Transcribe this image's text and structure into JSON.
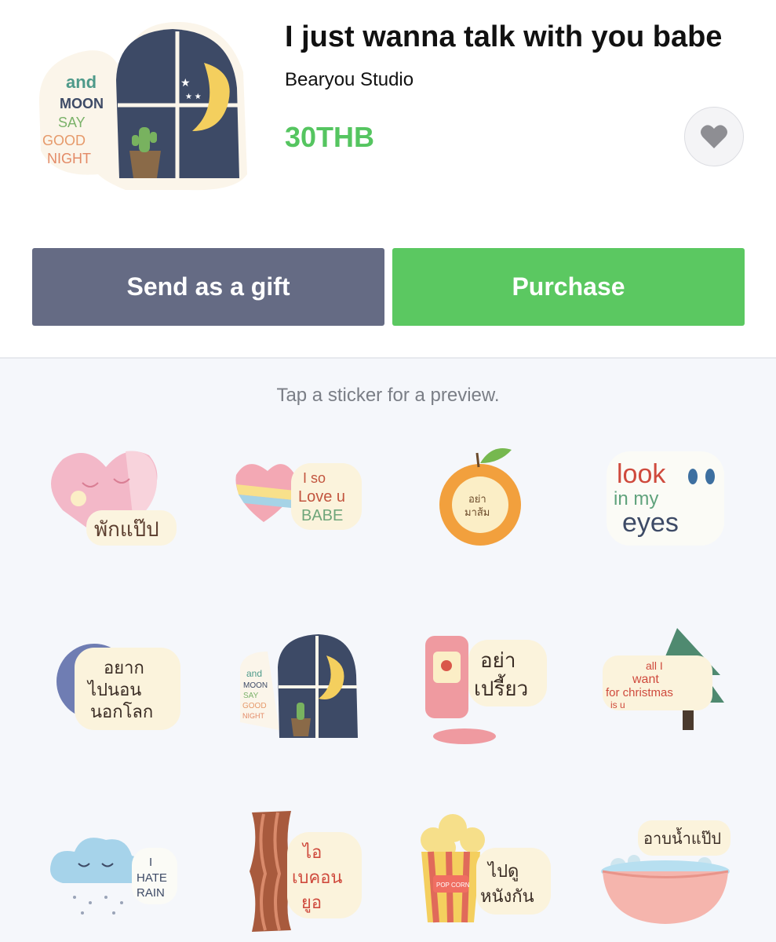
{
  "product": {
    "title": "I just wanna talk with you babe",
    "author": "Bearyou Studio",
    "price": "30THB",
    "main_sticker_text": [
      "and",
      "MOON",
      "SAY",
      "GOOD",
      "NIGHT"
    ]
  },
  "actions": {
    "gift_label": "Send as a gift",
    "purchase_label": "Purchase"
  },
  "preview": {
    "hint": "Tap a sticker for a preview."
  },
  "stickers": [
    {
      "name": "sticker-pink-heart-sleep",
      "text": [
        "พักแป๊ป"
      ]
    },
    {
      "name": "sticker-i-so-love-u-babe",
      "text": [
        "I so",
        "Love u",
        "BABE"
      ]
    },
    {
      "name": "sticker-orange",
      "text": [
        "อย่า",
        "มาส้ม"
      ]
    },
    {
      "name": "sticker-look-in-my-eyes",
      "text": [
        "look",
        "in my",
        "eyes"
      ]
    },
    {
      "name": "sticker-moon-want-sleep",
      "text": [
        "อยาก",
        "ไปนอน",
        "นอกโลก"
      ]
    },
    {
      "name": "sticker-and-moon-say-good-night",
      "text": [
        "and",
        "MOON",
        "SAY",
        "GOOD",
        "NIGHT"
      ]
    },
    {
      "name": "sticker-ketchup",
      "text": [
        "อย่า",
        "เปรี้ยว"
      ]
    },
    {
      "name": "sticker-christmas-tree",
      "text": [
        "all I",
        "want",
        "for christmas",
        "is u"
      ]
    },
    {
      "name": "sticker-i-hate-rain",
      "text": [
        "I",
        "HATE",
        "RAIN"
      ]
    },
    {
      "name": "sticker-bacon",
      "text": [
        "ไอ",
        "เบคอน",
        "ยูอ"
      ]
    },
    {
      "name": "sticker-popcorn",
      "text": [
        "POP CORN",
        "ไปดู",
        "หนังกัน"
      ]
    },
    {
      "name": "sticker-bathtub",
      "text": [
        "อาบน้ำแป๊ป"
      ]
    }
  ],
  "colors": {
    "price": "#55c560",
    "gift_button": "#656b84",
    "purchase_button": "#5bc861",
    "preview_bg": "#f5f7fb"
  },
  "icons": {
    "favorite": "heart-icon"
  }
}
